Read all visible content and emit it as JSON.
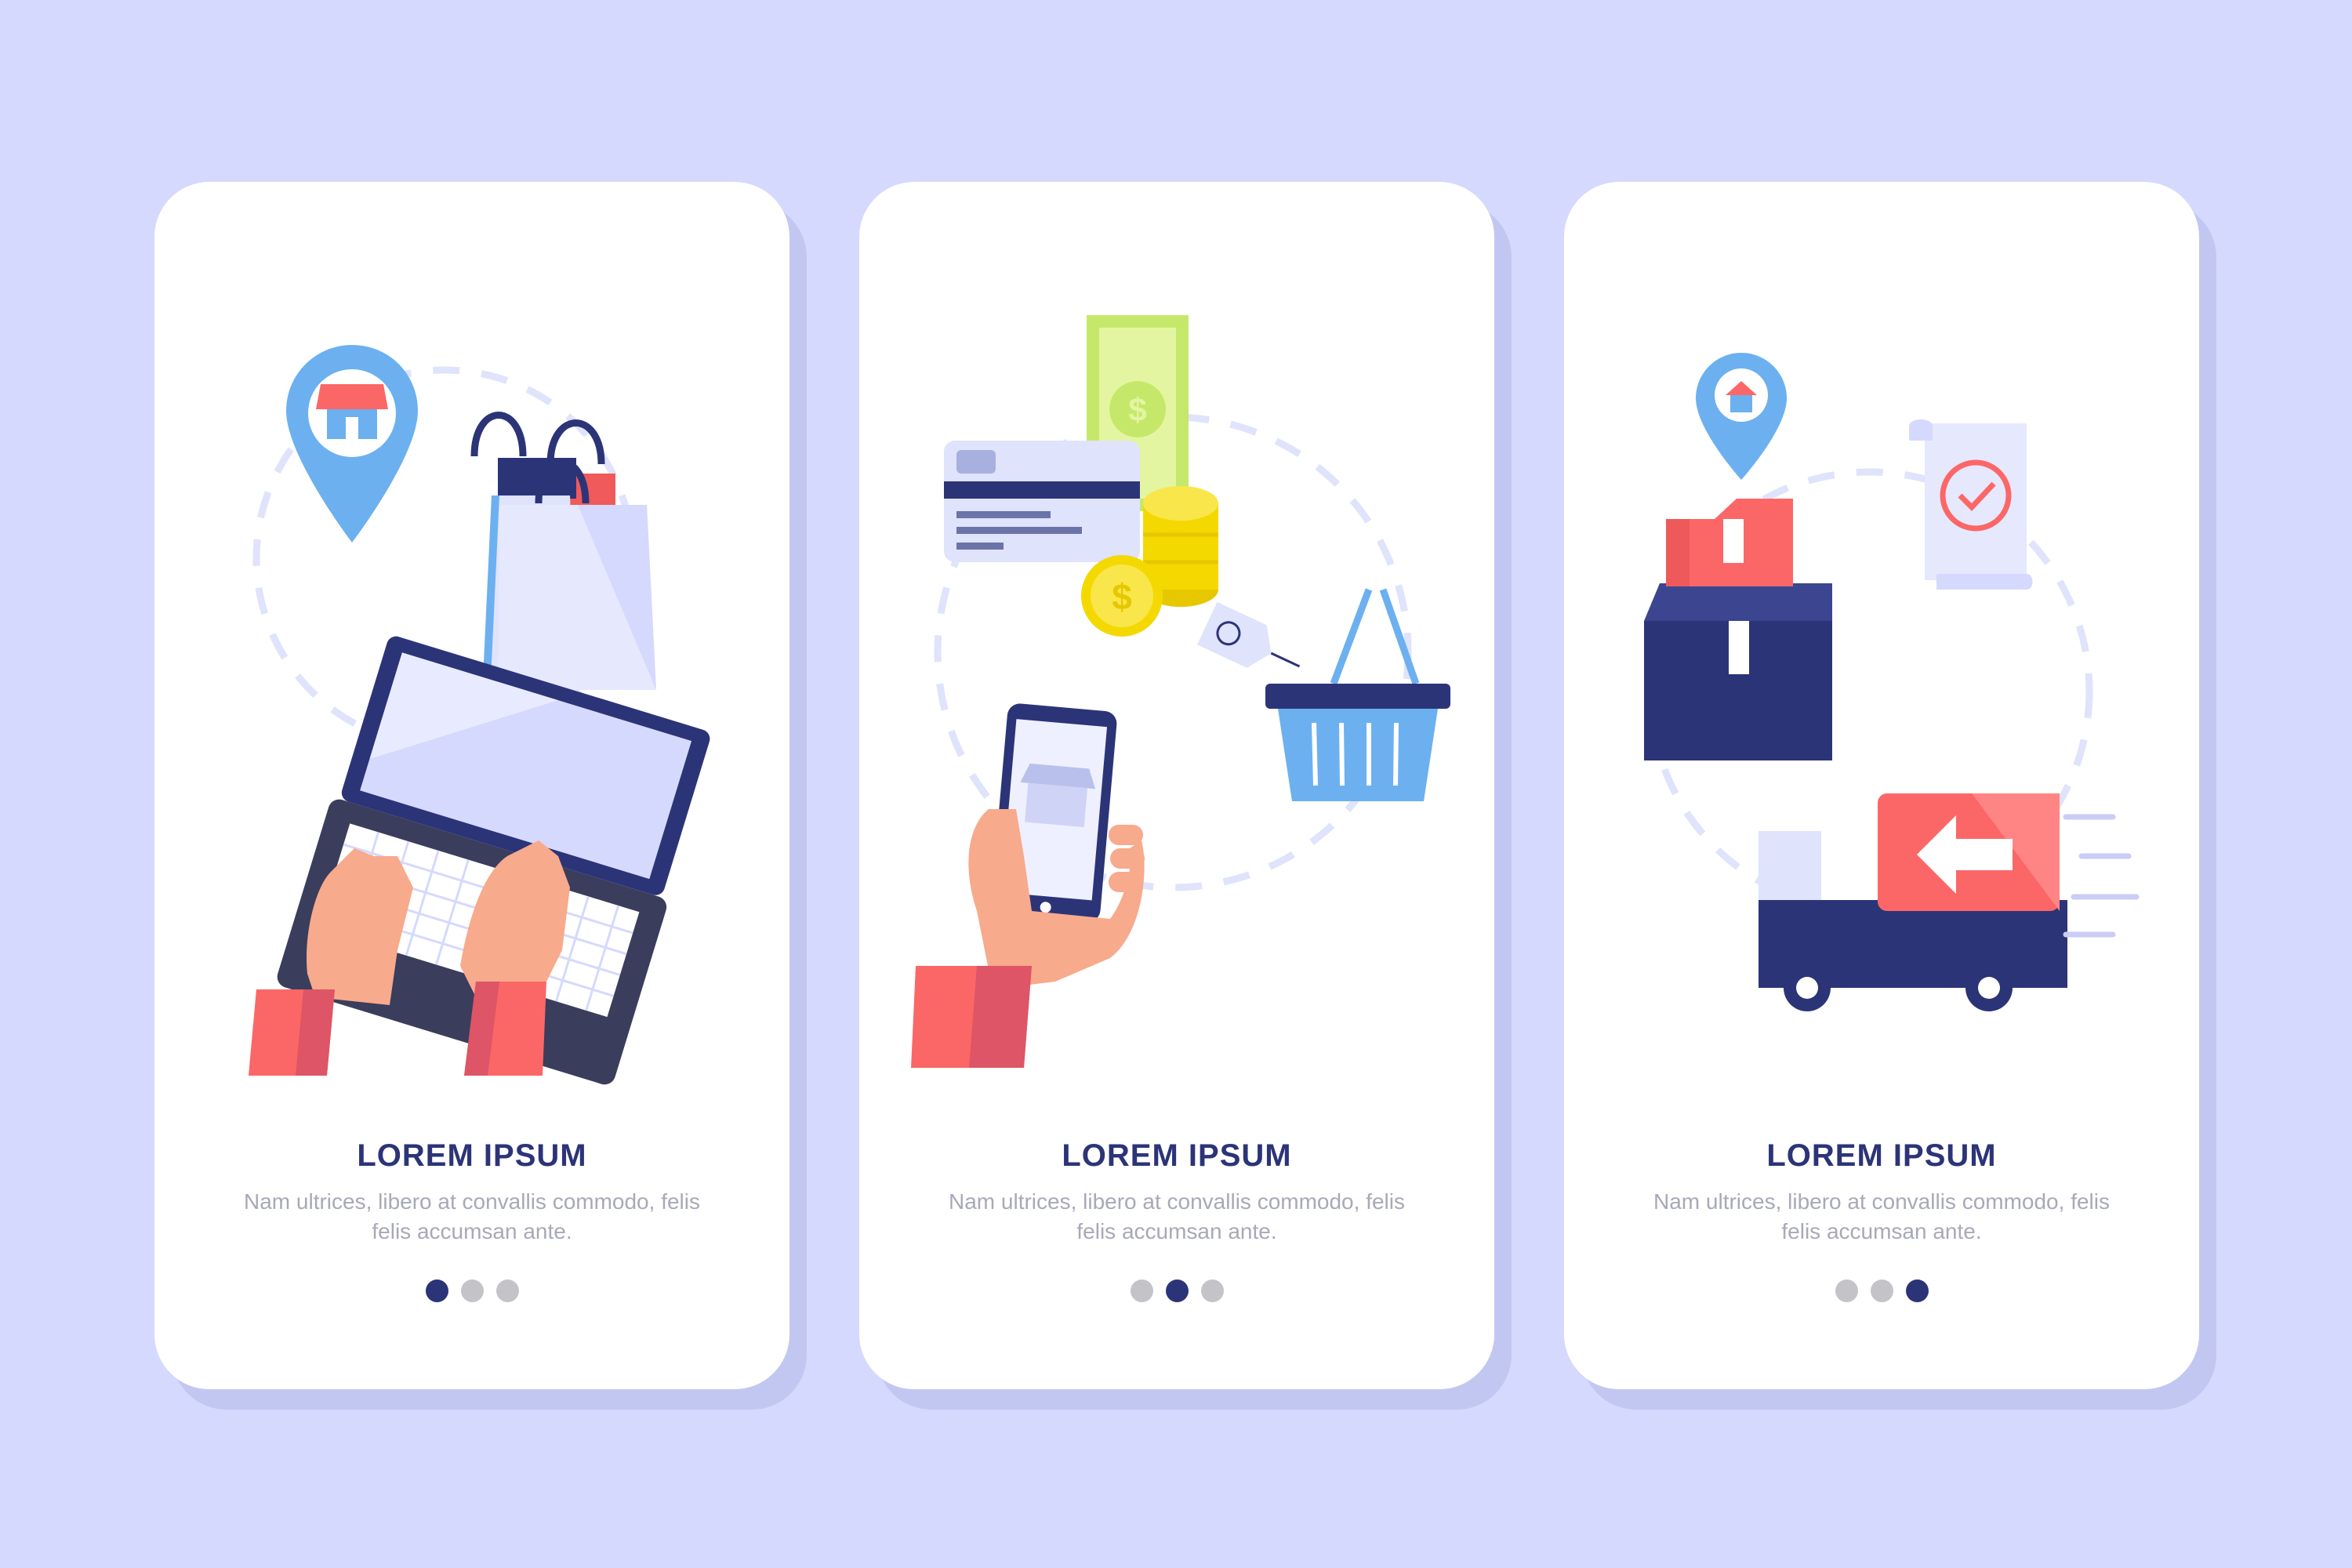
{
  "colors": {
    "background": "#d5d9fd",
    "card": "#ffffff",
    "navy": "#2c3478",
    "coral": "#fb6767",
    "blue": "#6cb0f0",
    "gray_dot": "#c4c4c8"
  },
  "screens": [
    {
      "title": "LOREM IPSUM",
      "description": "Nam ultrices, libero at convallis commodo, felis felis accumsan ante.",
      "active_dot": 1,
      "icons": [
        "store-location-pin-icon",
        "shopping-bags-icon",
        "laptop-icon",
        "typing-hands-icon"
      ]
    },
    {
      "title": "LOREM IPSUM",
      "description": "Nam ultrices, libero at convallis commodo, felis felis accumsan ante.",
      "active_dot": 2,
      "icons": [
        "banknote-icon",
        "credit-card-icon",
        "coins-icon",
        "price-tag-icon",
        "shopping-basket-icon",
        "smartphone-hand-icon"
      ]
    },
    {
      "title": "LOREM IPSUM",
      "description": "Nam ultrices, libero at convallis commodo, felis felis accumsan ante.",
      "active_dot": 3,
      "icons": [
        "home-location-pin-icon",
        "receipt-check-icon",
        "parcel-boxes-icon",
        "delivery-truck-icon"
      ]
    }
  ],
  "pagination": {
    "total": 3
  }
}
